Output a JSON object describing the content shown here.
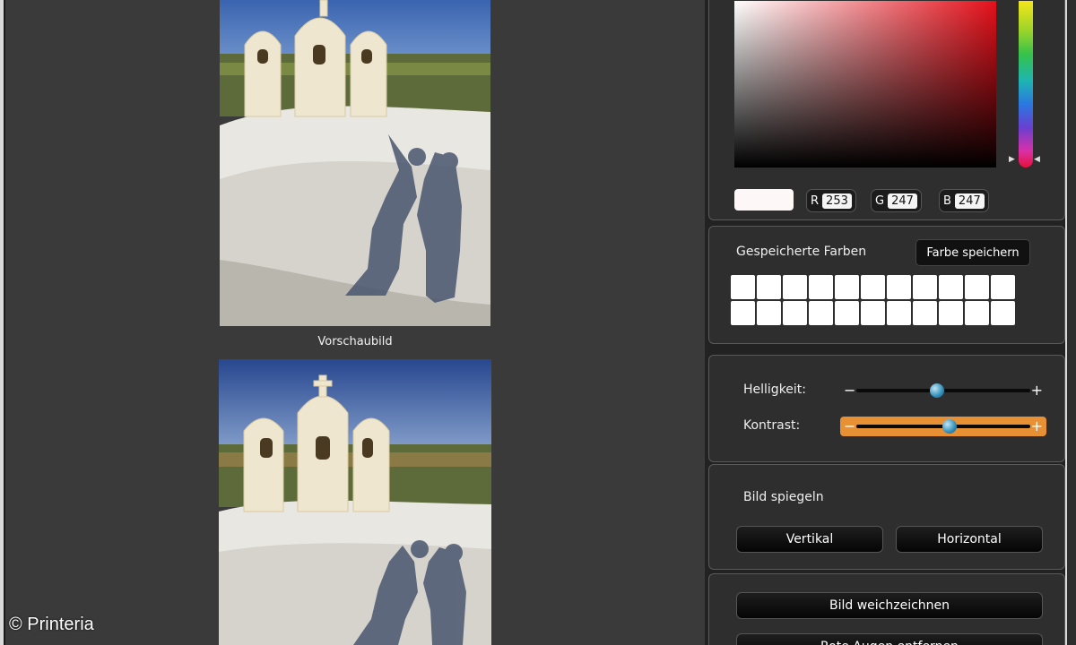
{
  "preview": {
    "caption": "Vorschaubild"
  },
  "credit": "© Printeria",
  "color_picker": {
    "current_color": "#fdf7f7",
    "r_label": "R",
    "r_value": "253",
    "g_label": "G",
    "g_value": "247",
    "b_label": "B",
    "b_value": "247"
  },
  "saved_colors": {
    "title": "Gespeicherte Farben",
    "save_button": "Farbe speichern",
    "swatch_count": 22
  },
  "adjust": {
    "brightness_label": "Helligkeit:",
    "brightness_value": 0.46,
    "contrast_label": "Kontrast:",
    "contrast_value": 0.54,
    "minus": "−",
    "plus": "+"
  },
  "mirror": {
    "title": "Bild spiegeln",
    "vertical": "Vertikal",
    "horizontal": "Horizontal"
  },
  "effects": {
    "soften": "Bild weichzeichnen",
    "red_eye": "Rote Augen entfernen"
  },
  "colors": {
    "accent": "#e89034",
    "panel": "#2e2e2e",
    "background": "#3a3a3a"
  }
}
